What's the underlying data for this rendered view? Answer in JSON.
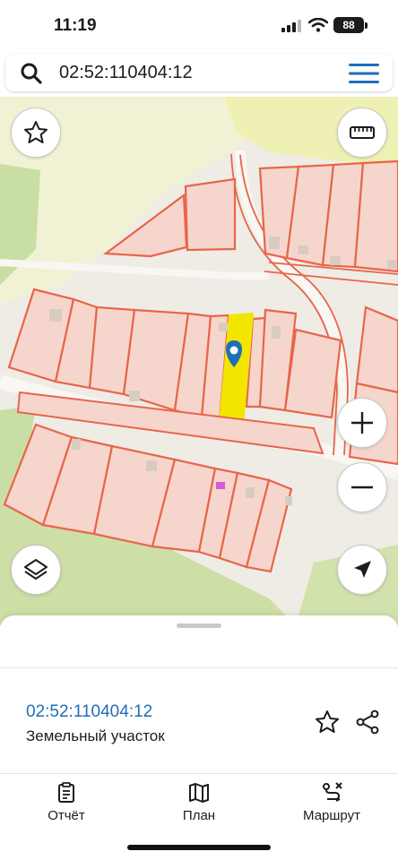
{
  "status_bar": {
    "time": "11:19",
    "battery": "88"
  },
  "search": {
    "value": "02:52:110404:12"
  },
  "map": {
    "buttons": [
      "favorites-star",
      "ruler",
      "zoom-in",
      "zoom-out",
      "layers",
      "my-location"
    ],
    "selected_parcel_color": "#f2e600",
    "parcel_fill": "#f6d6cc",
    "parcel_stroke": "#e8654a",
    "marker_color": "#1f6fb8"
  },
  "sheet": {
    "cadastral_number": "02:52:110404:12",
    "object_type": "Земельный участок"
  },
  "tabbar": {
    "report": "Отчёт",
    "plan": "План",
    "route": "Маршрут"
  },
  "colors": {
    "accent": "#1e6fb8"
  }
}
